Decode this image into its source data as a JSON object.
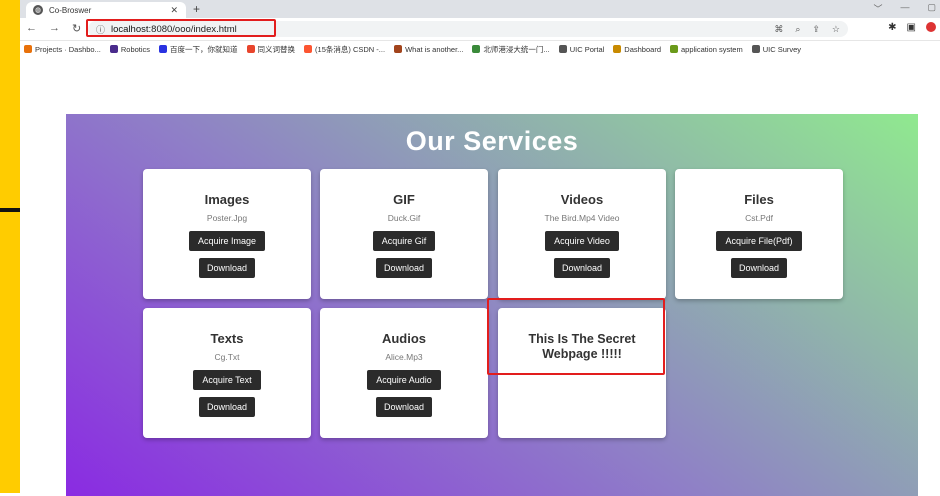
{
  "browser": {
    "tab_title": "Co-Broswer",
    "url_host": "localhost",
    "url_rest": ":8080/ooo/index.html",
    "bookmarks": [
      {
        "label": "Projects · Dashbo...",
        "color": "#e8710a"
      },
      {
        "label": "Robotics",
        "color": "#4a2b8c"
      },
      {
        "label": "百度一下，你就知道",
        "color": "#2932e1"
      },
      {
        "label": "同义词替换",
        "color": "#e8452c"
      },
      {
        "label": "(15条消息) CSDN -...",
        "color": "#fc5531"
      },
      {
        "label": "What is another...",
        "color": "#a2441c"
      },
      {
        "label": "北师港浸大统一门...",
        "color": "#3a8a3a"
      },
      {
        "label": "UIC Portal",
        "color": "#555555"
      },
      {
        "label": "Dashboard",
        "color": "#c88a00"
      },
      {
        "label": "application system",
        "color": "#6a9a1a"
      },
      {
        "label": "UIC Survey",
        "color": "#555555"
      }
    ]
  },
  "page": {
    "heading": "Our Services",
    "cards": [
      {
        "title": "Images",
        "file": "Poster.Jpg",
        "action": "Acquire Image",
        "download": "Download"
      },
      {
        "title": "GIF",
        "file": "Duck.Gif",
        "action": "Acquire Gif",
        "download": "Download"
      },
      {
        "title": "Videos",
        "file": "The Bird.Mp4 Video",
        "action": "Acquire Video",
        "download": "Download"
      },
      {
        "title": "Files",
        "file": "Cst.Pdf",
        "action": "Acquire File(Pdf)",
        "download": "Download"
      },
      {
        "title": "Texts",
        "file": "Cg.Txt",
        "action": "Acquire Text",
        "download": "Download"
      },
      {
        "title": "Audios",
        "file": "Alice.Mp3",
        "action": "Acquire Audio",
        "download": "Download"
      }
    ],
    "secret_card": {
      "title": "This Is The Secret Webpage !!!!!"
    }
  },
  "colors": {
    "highlight": "#e21d1d",
    "frame": "#ffcc00",
    "button": "#2b2b2b"
  }
}
